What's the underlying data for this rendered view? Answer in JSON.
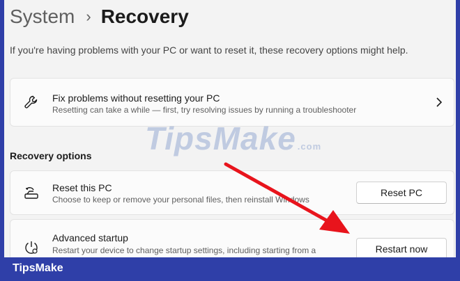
{
  "breadcrumb": {
    "parent": "System",
    "separator": "›",
    "current": "Recovery"
  },
  "subtitle": "If you're having problems with your PC or want to reset it, these recovery options might help.",
  "fix_card": {
    "icon": "wrench-icon",
    "title": "Fix problems without resetting your PC",
    "description": "Resetting can take a while — first, try resolving issues by running a troubleshooter"
  },
  "section": {
    "title": "Recovery options"
  },
  "options": [
    {
      "icon": "reset-pc-icon",
      "title": "Reset this PC",
      "description": "Choose to keep or remove your personal files, then reinstall Windows",
      "button_label": "Reset PC"
    },
    {
      "icon": "advanced-startup-icon",
      "title": "Advanced startup",
      "description": "Restart your device to change startup settings, including starting from a",
      "button_label": "Restart now"
    }
  ],
  "watermark": {
    "main": "TipsMake",
    "suffix": ".com"
  },
  "footer": {
    "brand": "TipsMake"
  },
  "colors": {
    "frame_border": "#2f3fa8",
    "annotation_arrow": "#e8141c",
    "page_background": "#f3f3f3"
  }
}
